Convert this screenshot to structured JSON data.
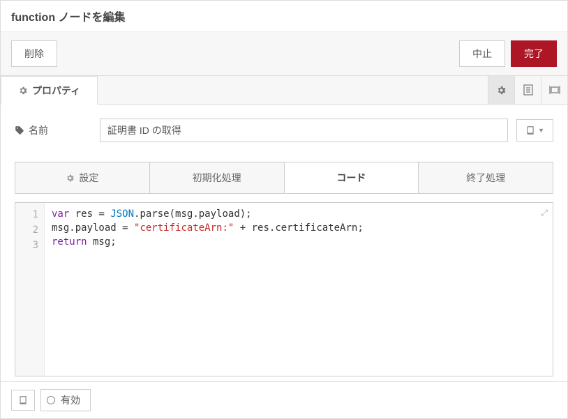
{
  "header": {
    "title": "function ノードを編集"
  },
  "actions": {
    "delete": "削除",
    "cancel": "中止",
    "done": "完了"
  },
  "mainTab": {
    "label": "プロパティ"
  },
  "form": {
    "name_label": "名前",
    "name_value": "証明書 ID の取得"
  },
  "codeTabs": {
    "setup": "設定",
    "init": "初期化処理",
    "code": "コード",
    "close": "終了処理"
  },
  "code": {
    "lines": [
      "1",
      "2",
      "3"
    ],
    "l1_kw1": "var",
    "l1_var": " res ",
    "l1_op": "= ",
    "l1_t1": "JSON",
    "l1_t2": ".parse(msg.payload);",
    "l2_t1": "msg.payload = ",
    "l2_str": "\"certificateArn:\"",
    "l2_t2": " + res.certificateArn;",
    "l3_kw": "return",
    "l3_t": " msg;"
  },
  "footer": {
    "enabled_label": "有効"
  }
}
